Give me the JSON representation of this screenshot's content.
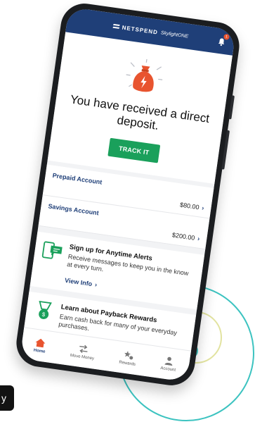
{
  "header": {
    "brand": "NETSPEND",
    "product": "SkylightONE",
    "badge_count": "1"
  },
  "hero": {
    "title": "You have received a direct deposit.",
    "button_label": "TRACK IT"
  },
  "accounts": [
    {
      "name": "Prepaid Account",
      "balance": "$80.00"
    },
    {
      "name": "Savings Account",
      "balance": "$200.00"
    }
  ],
  "alerts_card": {
    "title": "Sign up for Anytime Alerts",
    "text": "Receive messages to keep you in the know at every turn.",
    "link": "View Info"
  },
  "rewards_card": {
    "title": "Learn about Payback Rewards",
    "text": "Earn cash back for many of your everyday purchases."
  },
  "tabs": [
    {
      "label": "Home",
      "icon": "home-icon"
    },
    {
      "label": "Move Money",
      "icon": "transfer-icon"
    },
    {
      "label": "Rewards",
      "icon": "rewards-icon"
    },
    {
      "label": "Account",
      "icon": "person-icon"
    }
  ],
  "corner_tag": {
    "text": "y"
  },
  "colors": {
    "brand_blue": "#1f3f78",
    "green": "#1aa05b",
    "orange": "#e8542f",
    "teal": "#3cc3c0"
  }
}
